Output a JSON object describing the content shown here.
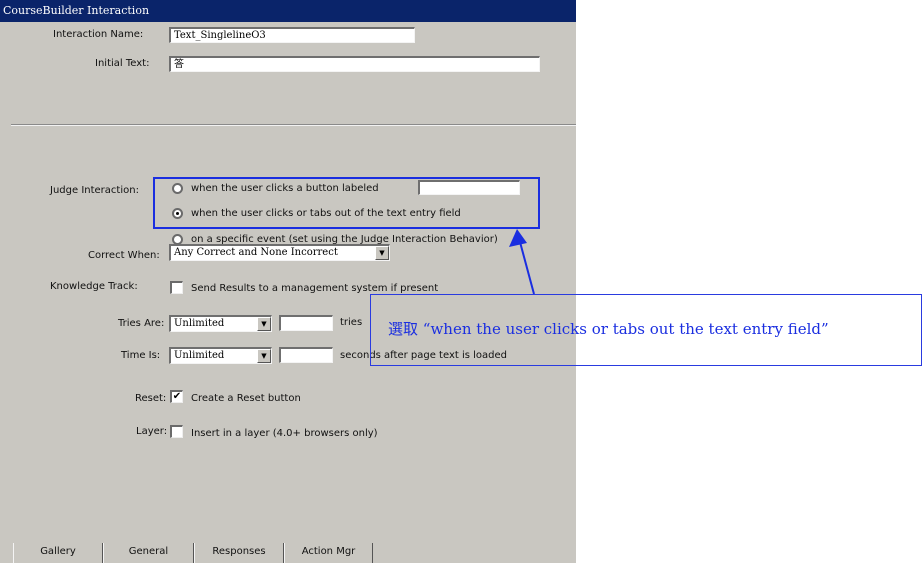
{
  "window": {
    "title": "CourseBuilder Interaction"
  },
  "fields": {
    "interaction_name_label": "Interaction Name:",
    "interaction_name_value": "Text_SinglelineO3",
    "initial_text_label": "Initial Text:",
    "initial_text_value": "答"
  },
  "judge": {
    "label": "Judge Interaction:",
    "options": [
      {
        "label": "when the user clicks a button labeled",
        "selected": false
      },
      {
        "label": "when the user clicks or tabs out of the text entry field",
        "selected": true
      },
      {
        "label": "on a specific event (set using the Judge Interaction Behavior)",
        "selected": false
      }
    ]
  },
  "correct_when": {
    "label": "Correct When:",
    "value": "Any Correct and None Incorrect"
  },
  "knowledge_track": {
    "label": "Knowledge Track:",
    "text": "Send Results to a management system if present",
    "checked": false
  },
  "tries": {
    "label": "Tries Are:",
    "value": "Unlimited",
    "suffix": "tries"
  },
  "time": {
    "label": "Time Is:",
    "value": "Unlimited",
    "suffix": "seconds after page text is loaded"
  },
  "reset": {
    "label": "Reset:",
    "text": "Create a Reset button",
    "checked": true
  },
  "layer": {
    "label": "Layer:",
    "text": "Insert in a layer (4.0+ browsers only)",
    "checked": false
  },
  "tabs": [
    {
      "label": "Gallery",
      "active": false
    },
    {
      "label": "General",
      "active": true
    },
    {
      "label": "Responses",
      "active": false
    },
    {
      "label": "Action Mgr",
      "active": false
    }
  ],
  "annotation": {
    "prefix": "選取",
    "text": "“when the user clicks or tabs out the text entry field”",
    "color": "#1a2ee0"
  },
  "glyphs": {
    "check": "✔",
    "arrow": "▼"
  }
}
